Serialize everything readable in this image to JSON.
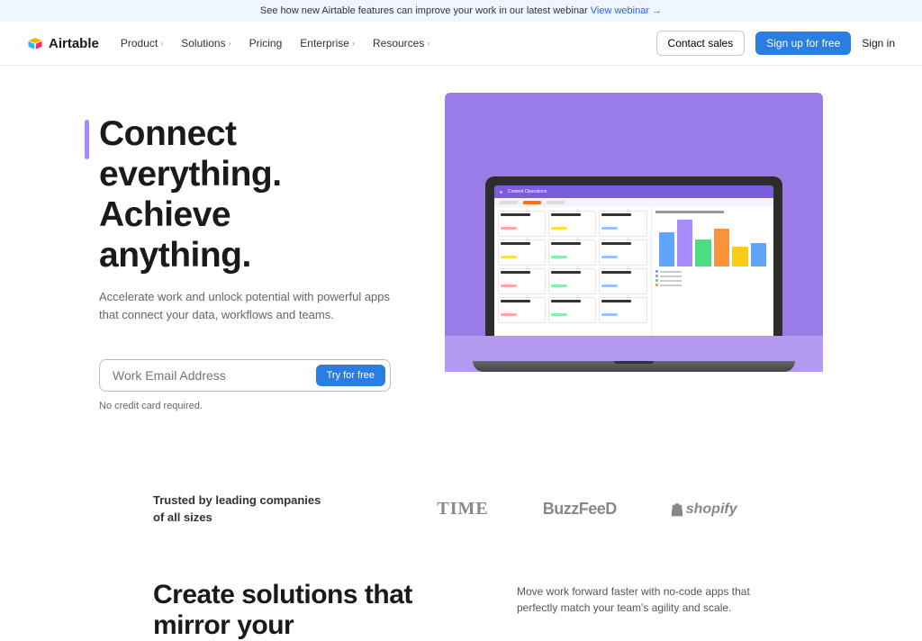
{
  "banner": {
    "text": "See how new Airtable features can improve your work in our latest webinar",
    "link_text": "View webinar →"
  },
  "brand": "Airtable",
  "nav": {
    "items": [
      {
        "label": "Product",
        "has_dropdown": true
      },
      {
        "label": "Solutions",
        "has_dropdown": true
      },
      {
        "label": "Pricing",
        "has_dropdown": false
      },
      {
        "label": "Enterprise",
        "has_dropdown": true
      },
      {
        "label": "Resources",
        "has_dropdown": true
      }
    ],
    "contact_sales": "Contact sales",
    "signup": "Sign up for free",
    "signin": "Sign in"
  },
  "hero": {
    "title_line1": "Connect",
    "title_line2": "everything.",
    "title_line3": "Achieve anything.",
    "subtitle": "Accelerate work and unlock potential with powerful apps that connect your data, workflows and teams.",
    "email_placeholder": "Work Email Address",
    "try_button": "Try for free",
    "no_credit": "No credit card required."
  },
  "mock_app": {
    "title": "Content Operations",
    "chart_colors": [
      "#60a5fa",
      "#a78bfa",
      "#4ade80",
      "#fb923c",
      "#facc15",
      "#60a5fa"
    ],
    "bar_heights": [
      38,
      52,
      30,
      42,
      22,
      26
    ]
  },
  "trusted": {
    "text": "Trusted by leading companies of all sizes",
    "logos": [
      "TIME",
      "BuzzFeeD",
      "shopify"
    ]
  },
  "solutions": {
    "title": "Create solutions that mirror your",
    "subtitle": "Move work forward faster with no-code apps that perfectly match your team's agility and scale."
  }
}
